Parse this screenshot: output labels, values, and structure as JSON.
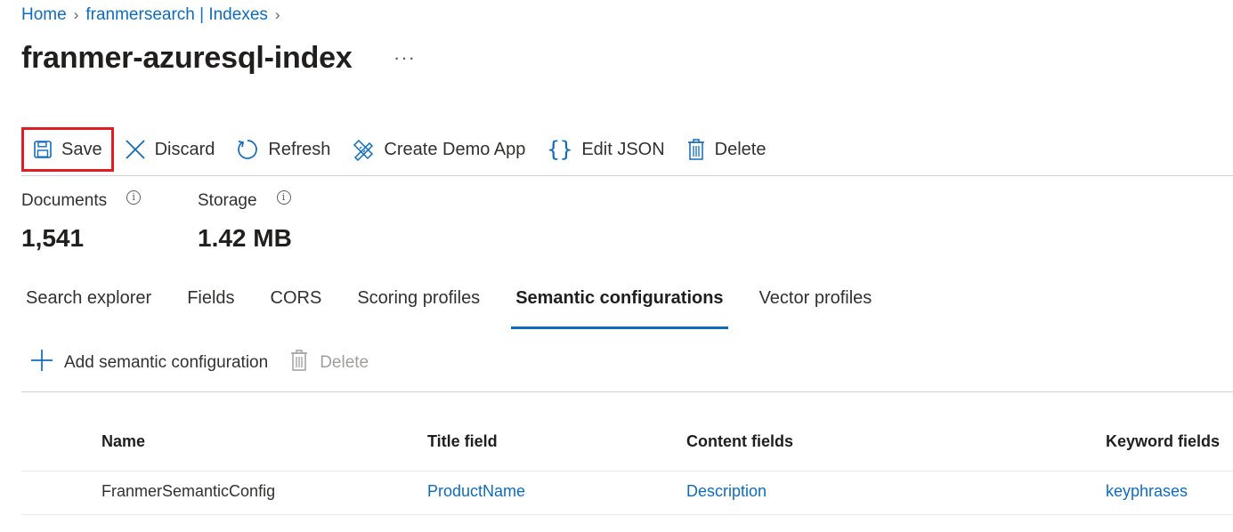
{
  "breadcrumb": {
    "home": "Home",
    "service": "franmersearch | Indexes"
  },
  "page": {
    "title": "franmer-azuresql-index",
    "more": "···"
  },
  "toolbar": {
    "save": "Save",
    "discard": "Discard",
    "refresh": "Refresh",
    "create_demo_app": "Create Demo App",
    "edit_json": "Edit JSON",
    "delete": "Delete"
  },
  "stats": {
    "documents_label": "Documents",
    "documents_value": "1,541",
    "storage_label": "Storage",
    "storage_value": "1.42 MB"
  },
  "tabs": [
    {
      "label": "Search explorer",
      "active": false
    },
    {
      "label": "Fields",
      "active": false
    },
    {
      "label": "CORS",
      "active": false
    },
    {
      "label": "Scoring profiles",
      "active": false
    },
    {
      "label": "Semantic configurations",
      "active": true
    },
    {
      "label": "Vector profiles",
      "active": false
    }
  ],
  "subbar": {
    "add": "Add semantic configuration",
    "delete": "Delete"
  },
  "table": {
    "headers": [
      "Name",
      "Title field",
      "Content fields",
      "Keyword fields"
    ],
    "rows": [
      {
        "name": "FranmerSemanticConfig",
        "title_field": "ProductName",
        "content_fields": "Description",
        "keyword_fields": "keyphrases"
      }
    ]
  },
  "colors": {
    "accent": "#0f6cbd",
    "highlight_border": "#e01e22"
  }
}
